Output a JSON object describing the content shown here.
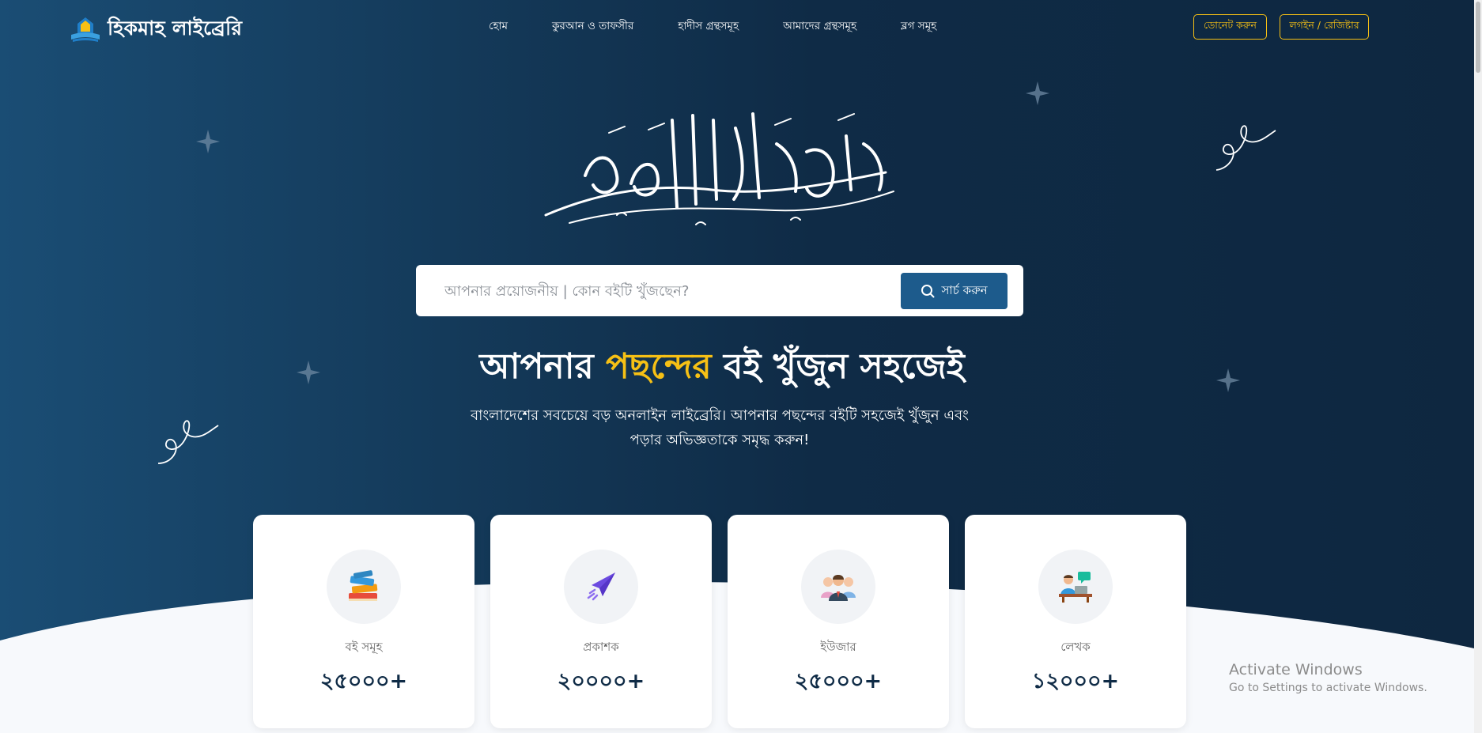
{
  "brand": {
    "name": "হিকমাহ লাইব্রেরি"
  },
  "nav": {
    "items": [
      {
        "label": "হোম"
      },
      {
        "label": "কুরআন ও তাফসীর"
      },
      {
        "label": "হাদীস গ্রন্থসমূহ"
      },
      {
        "label": "আমাদের গ্রন্থসমূহ"
      },
      {
        "label": "ব্লগ সমূহ"
      }
    ],
    "donate_label": "ডোনেট করুন",
    "login_label": "লগইন / রেজিষ্টার"
  },
  "search": {
    "placeholder": "আপনার প্রয়োজনীয় | কোন বইটি খুঁজছেন?",
    "button_label": "সার্চ করুন"
  },
  "hero": {
    "title_part1": "আপনার ",
    "title_highlight": "পছন্দের",
    "title_part2": " বই খুঁজুন সহজেই",
    "subtitle": "বাংলাদেশের সবচেয়ে বড় অনলাইন লাইব্রেরি। আপনার পছন্দের বইটি সহজেই খুঁজুন এবং পড়ার অভিজ্ঞতাকে সমৃদ্ধ করুন!"
  },
  "stats": [
    {
      "label": "বই সমূহ",
      "value": "২৫০০০+",
      "icon": "books-icon"
    },
    {
      "label": "প্রকাশক",
      "value": "২০০০০+",
      "icon": "paper-plane-icon"
    },
    {
      "label": "ইউজার",
      "value": "২৫০০০+",
      "icon": "users-icon"
    },
    {
      "label": "লেখক",
      "value": "১২০০০+",
      "icon": "writer-icon"
    }
  ],
  "watermark": {
    "title": "Activate Windows",
    "subtitle": "Go to Settings to activate Windows."
  },
  "colors": {
    "accent": "#f6c015",
    "navy": "#0f2b46",
    "button": "#1d5b8c"
  }
}
